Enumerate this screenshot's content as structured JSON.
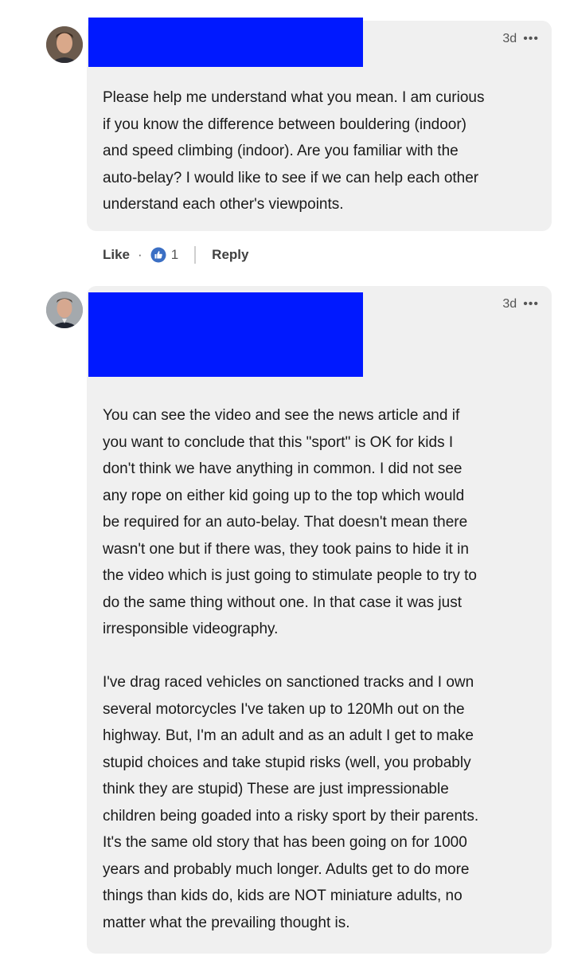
{
  "comments": [
    {
      "time": "3d",
      "more_label": "•••",
      "text": "Please help me understand what you mean. I am curious\nif you know the difference between bouldering (indoor)\nand speed climbing (indoor). Are you familiar with the\nauto-belay? I would like to see if we can help each other\nunderstand each other's viewpoints.",
      "actions": {
        "like_label": "Like",
        "separator": "·",
        "reaction_count": "1",
        "reply_label": "Reply"
      }
    },
    {
      "time": "3d",
      "more_label": "•••",
      "text": "You can see the video and see the news article and if\nyou want to conclude that this \"sport\" is OK for kids I\ndon't think we have anything in common. I did not see\nany rope on either kid going up to the top which would\nbe required for an auto-belay. That doesn't mean there\nwasn't one but if there was, they took pains to hide it in\nthe video which is just going to stimulate people to try to\ndo the same thing without one. In that case it was just\nirresponsible videography.\n\nI've drag raced vehicles on sanctioned tracks and I own\nseveral motorcycles I've taken up to 120Mh out on the\nhighway. But, I'm an adult and as an adult I get to make\nstupid choices and take stupid risks (well, you probably\nthink they are stupid) These are just impressionable\nchildren being goaded into a risky sport by their parents.\nIt's the same old story that has been going on for 1000\nyears and probably much longer. Adults get to do more\nthings than kids do, kids are NOT miniature adults, no\nmatter what the prevailing thought is."
    }
  ],
  "colors": {
    "redaction": "#0019ff",
    "bubble": "#f0f0f0",
    "like_icon": "#3b6fc4"
  },
  "icons": [
    "avatar",
    "like-reaction-icon",
    "more-options-icon"
  ]
}
